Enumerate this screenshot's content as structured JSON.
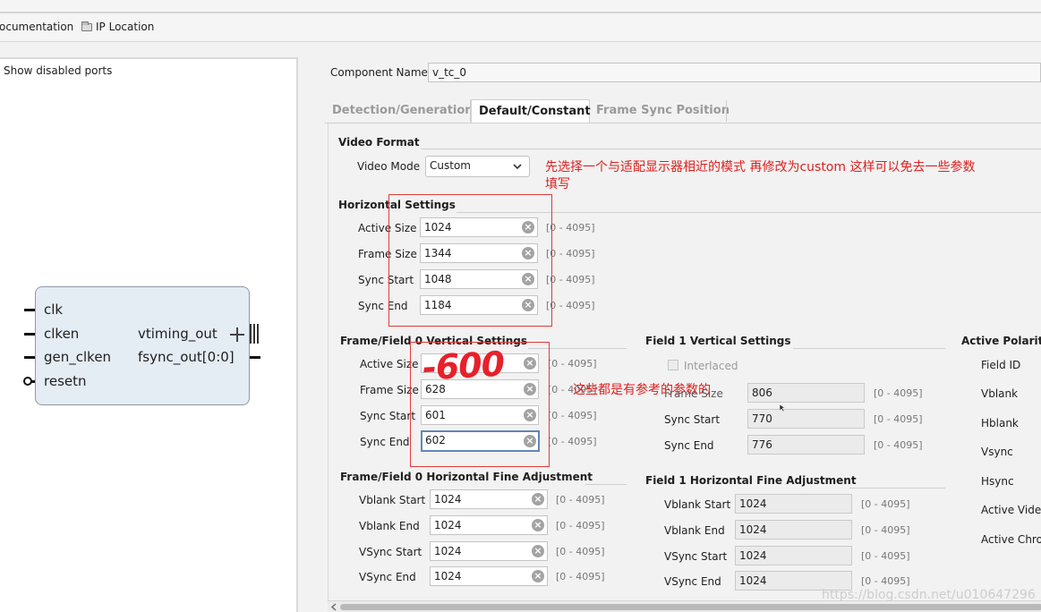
{
  "toolbar": {
    "documentation": "ocumentation",
    "ip_location": "IP Location"
  },
  "left_panel": {
    "show_disabled_ports": "Show disabled ports",
    "ports_left": [
      "clk",
      "clken",
      "gen_clken",
      "resetn"
    ],
    "ports_right": [
      "vtiming_out",
      "fsync_out[0:0]"
    ]
  },
  "component": {
    "label": "Component Name",
    "value": "v_tc_0"
  },
  "tabs": [
    "Detection/Generation",
    "Default/Constant",
    "Frame Sync Position"
  ],
  "video_format": {
    "title": "Video Format",
    "mode_label": "Video Mode",
    "mode_value": "Custom"
  },
  "horizontal": {
    "title": "Horizontal Settings",
    "rows": [
      {
        "label": "Active Size",
        "value": "1024",
        "range": "[0 - 4095]"
      },
      {
        "label": "Frame Size",
        "value": "1344",
        "range": "[0 - 4095]"
      },
      {
        "label": "Sync Start",
        "value": "1048",
        "range": "[0 - 4095]"
      },
      {
        "label": "Sync End",
        "value": "1184",
        "range": "[0 - 4095]"
      }
    ]
  },
  "vertical0": {
    "title": "Frame/Field 0 Vertical Settings",
    "rows": [
      {
        "label": "Active Size",
        "value": "",
        "range": "[0 - 4095]"
      },
      {
        "label": "Frame Size",
        "value": "628",
        "range": "[0 - 4095]"
      },
      {
        "label": "Sync Start",
        "value": "601",
        "range": "[0 - 4095]"
      },
      {
        "label": "Sync End",
        "value": "602",
        "range": "[0 - 4095]"
      }
    ]
  },
  "fine0": {
    "title": "Frame/Field 0 Horizontal Fine Adjustment",
    "rows": [
      {
        "label": "Vblank Start",
        "value": "1024",
        "range": "[0 - 4095]"
      },
      {
        "label": "Vblank End",
        "value": "1024",
        "range": "[0 - 4095]"
      },
      {
        "label": "VSync Start",
        "value": "1024",
        "range": "[0 - 4095]"
      },
      {
        "label": "VSync End",
        "value": "1024",
        "range": "[0 - 4095]"
      }
    ]
  },
  "field1_vertical": {
    "title": "Field 1 Vertical Settings",
    "interlaced": "Interlaced",
    "rows": [
      {
        "label": "Frame Size",
        "value": "806",
        "range": "[0 - 4095]"
      },
      {
        "label": "Sync Start",
        "value": "770",
        "range": "[0 - 4095]"
      },
      {
        "label": "Sync End",
        "value": "776",
        "range": "[0 - 4095]"
      }
    ]
  },
  "field1_fine": {
    "title": "Field 1 Horizontal Fine Adjustment",
    "rows": [
      {
        "label": "Vblank Start",
        "value": "1024",
        "range": "[0 - 4095]"
      },
      {
        "label": "Vblank End",
        "value": "1024",
        "range": "[0 - 4095]"
      },
      {
        "label": "VSync Start",
        "value": "1024",
        "range": "[0 - 4095]"
      },
      {
        "label": "VSync End",
        "value": "1024",
        "range": "[0 - 4095]"
      }
    ]
  },
  "polarity": {
    "title": "Active Polarity",
    "items": [
      "Field ID",
      "Vblank",
      "Hblank",
      "Vsync",
      "Hsync",
      "Active Video",
      "Active Chroma"
    ]
  },
  "annotations": {
    "mode_note_line1": "先选择一个与适配显示器相近的模式 再修改为custom 这样可以免去一些参数",
    "mode_note_line2": "填写",
    "handwritten": "-600",
    "ref_note": "这些都是有参考的参数的"
  },
  "watermark": "https://blog.csdn.net/u010647296",
  "colors": {
    "annotation_red": "#e02020",
    "block_fill": "#e4ecf4",
    "focus_border": "#5f86b8"
  }
}
